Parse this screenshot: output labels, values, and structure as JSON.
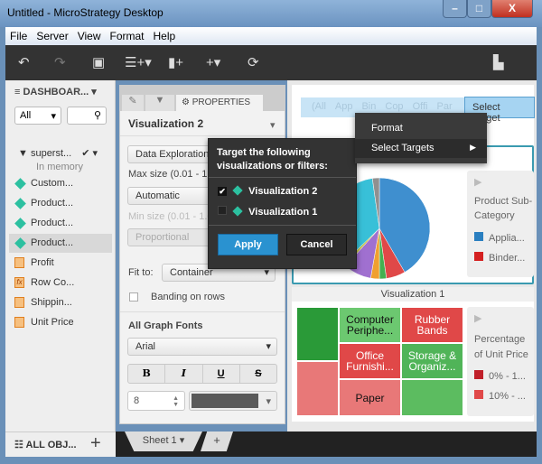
{
  "window": {
    "title": "Untitled - MicroStrategy Desktop",
    "minimize": "–",
    "maximize": "□",
    "close": "X"
  },
  "menu": [
    "File",
    "Server",
    "View",
    "Format",
    "Help"
  ],
  "toolbar": {
    "icons": [
      "undo-icon",
      "redo-icon",
      "save-icon",
      "add-data-icon",
      "add-visualization-icon",
      "insert-icon",
      "refresh-icon",
      "present-icon"
    ]
  },
  "left": {
    "header": "DASHBOAR...",
    "filter": "All",
    "dataset": "superst...",
    "dataset_status": "In memory",
    "attributes": [
      "Custom...",
      "Product...",
      "Product...",
      "Product..."
    ],
    "metrics": [
      {
        "label": "Profit",
        "type": "metric"
      },
      {
        "label": "Row Co...",
        "type": "derived"
      },
      {
        "label": "Shippin...",
        "type": "metric"
      },
      {
        "label": "Unit Price",
        "type": "metric"
      }
    ],
    "footer": "ALL OBJ..."
  },
  "props": {
    "tab": "PROPERTIES",
    "viz": "Visualization 2",
    "mode": "Data Exploration",
    "max_label": "Max size (0.01 - 1.",
    "max_val": "Automatic",
    "min_label": "Min size (0.01 - 1.0",
    "min_val": "Proportional",
    "fit_label": "Fit to:",
    "fit_val": "Container",
    "banding": "Banding on rows",
    "fonts_header": "All Graph Fonts",
    "font": "Arial",
    "bold": "B",
    "italic": "I",
    "underline": "U",
    "strike": "S",
    "size": "8",
    "font_color": "#5a5a5a"
  },
  "sheets": {
    "tab": "Sheet 1",
    "add": "+"
  },
  "filterbar": {
    "items": [
      "(All",
      "App",
      "Bin",
      "Cop",
      "Offi",
      "Par"
    ],
    "button": "Select Target"
  },
  "context_menu": {
    "items": [
      "Format",
      "Select Targets"
    ]
  },
  "dialog": {
    "title": "Target the following visualizations or filters:",
    "options": [
      {
        "label": "Visualization 2",
        "checked": true
      },
      {
        "label": "Visualization 1",
        "checked": false
      }
    ],
    "apply": "Apply",
    "cancel": "Cancel"
  },
  "viz2_legend": {
    "title": "Product Sub-Category",
    "items": [
      {
        "label": "Applia...",
        "color": "#2a7fc0"
      },
      {
        "label": "Binder...",
        "color": "#d42020"
      }
    ]
  },
  "viz1": {
    "title": "Visualization 1",
    "cells": [
      "Computer Periphe...",
      "Rubber Bands",
      "Office Furnishi...",
      "Storage & Organiz...",
      "Paper"
    ],
    "legend": {
      "title": "Percentage of Unit Price",
      "items": [
        {
          "label": "0% - 1...",
          "color": "#c0202a"
        },
        {
          "label": "10% - ...",
          "color": "#e04848"
        }
      ]
    }
  }
}
